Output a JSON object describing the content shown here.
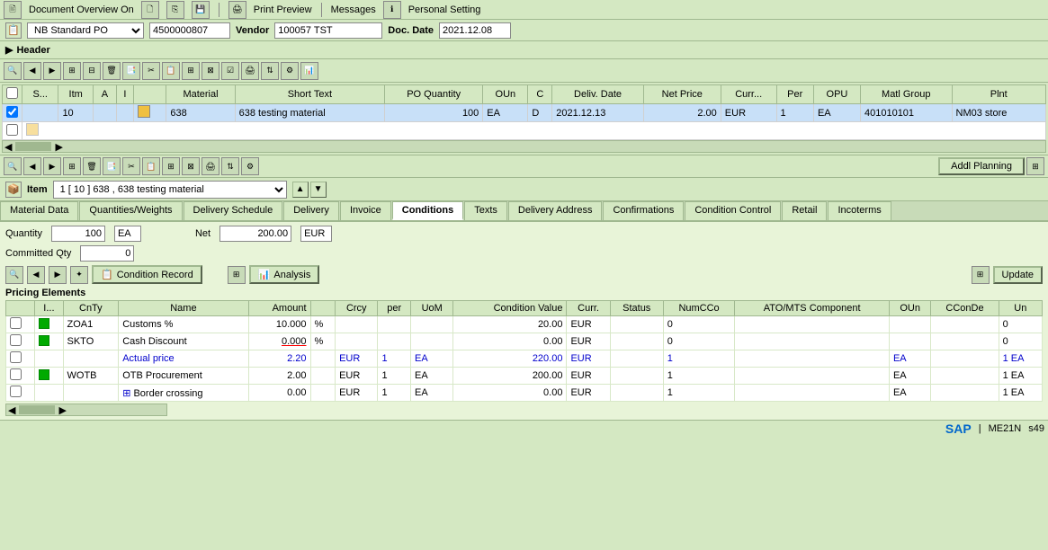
{
  "topbar": {
    "doc_overview": "Document Overview On",
    "print_preview": "Print Preview",
    "messages": "Messages",
    "personal_setting": "Personal Setting"
  },
  "header": {
    "label": "Header",
    "po_type_label": "NB Standard PO",
    "po_number": "4500000807",
    "vendor_label": "Vendor",
    "vendor_value": "100057 TST",
    "doc_date_label": "Doc. Date",
    "doc_date": "2021.12.08"
  },
  "po_table": {
    "columns": [
      "S...",
      "Itm",
      "A",
      "I",
      "Material",
      "Short Text",
      "PO Quantity",
      "OUn",
      "C",
      "Deliv. Date",
      "Net Price",
      "Curr...",
      "Per",
      "OPU",
      "Matl Group",
      "Plnt"
    ],
    "rows": [
      {
        "s": "",
        "itm": "10",
        "a": "",
        "i": "",
        "material": "638",
        "short_text": "638 testing material",
        "po_qty": "100",
        "oun": "EA",
        "c": "D",
        "deliv_date": "2021.12.13",
        "net_price": "2.00",
        "curr": "EUR",
        "per": "1",
        "opu": "EA",
        "matl_group": "401010101",
        "plnt": "NM03 store"
      }
    ]
  },
  "addl_planning": "Addl Planning",
  "item": {
    "label": "Item",
    "value": "1 [ 10 ] 638 , 638 testing material"
  },
  "tabs": [
    {
      "label": "Material Data",
      "active": false
    },
    {
      "label": "Quantities/Weights",
      "active": false
    },
    {
      "label": "Delivery Schedule",
      "active": false
    },
    {
      "label": "Delivery",
      "active": false
    },
    {
      "label": "Invoice",
      "active": false
    },
    {
      "label": "Conditions",
      "active": true
    },
    {
      "label": "Texts",
      "active": false
    },
    {
      "label": "Delivery Address",
      "active": false
    },
    {
      "label": "Confirmations",
      "active": false
    },
    {
      "label": "Condition Control",
      "active": false
    },
    {
      "label": "Retail",
      "active": false
    },
    {
      "label": "Incoterms",
      "active": false
    }
  ],
  "conditions": {
    "quantity_label": "Quantity",
    "quantity_value": "100",
    "quantity_unit": "EA",
    "net_label": "Net",
    "net_value": "200.00",
    "net_currency": "EUR",
    "committed_qty_label": "Committed Qty",
    "committed_qty_value": "0",
    "condition_record_btn": "Condition Record",
    "analysis_btn": "Analysis",
    "update_btn": "Update",
    "pricing_elements_label": "Pricing Elements"
  },
  "pricing_table": {
    "columns": [
      "I...",
      "CnTy",
      "Name",
      "Amount",
      "",
      "Crcy",
      "per",
      "UoM",
      "Condition Value",
      "",
      "Curr.",
      "Status",
      "NumCCo",
      "ATO/MTS Component",
      "OUn",
      "CConDe",
      "Un"
    ],
    "rows": [
      {
        "ind": "",
        "cnty": "ZOA1",
        "name": "Customs %",
        "amount": "10.000",
        "pct": "%",
        "crcy": "",
        "per": "",
        "uom": "",
        "cond_val": "20.00",
        "cv2": "",
        "curr": "EUR",
        "status": "",
        "numcco": "0",
        "ato": "",
        "oun": "",
        "cconde": "",
        "un": "0",
        "has_green": true,
        "is_actual": false,
        "is_strikethrough": false
      },
      {
        "ind": "",
        "cnty": "SKTO",
        "name": "Cash Discount",
        "amount": "0.000",
        "pct": "%",
        "crcy": "",
        "per": "",
        "uom": "",
        "cond_val": "0.00",
        "cv2": "",
        "curr": "EUR",
        "status": "",
        "numcco": "0",
        "ato": "",
        "oun": "",
        "cconde": "",
        "un": "0",
        "has_green": true,
        "is_actual": false,
        "is_strikethrough": false,
        "amount_underline_red": true
      },
      {
        "ind": "",
        "cnty": "",
        "name": "Actual price",
        "amount": "2.20",
        "pct": "",
        "crcy": "EUR",
        "per": "1",
        "uom": "EA",
        "cond_val": "220.00",
        "cv2": "",
        "curr": "EUR",
        "status": "",
        "numcco": "1",
        "ato": "",
        "oun": "EA",
        "cconde": "",
        "un": "1 EA",
        "has_green": false,
        "is_actual": true,
        "is_strikethrough": false
      },
      {
        "ind": "",
        "cnty": "WOTB",
        "name": "OTB Procurement",
        "amount": "2.00",
        "pct": "",
        "crcy": "EUR",
        "per": "1",
        "uom": "EA",
        "cond_val": "200.00",
        "cv2": "",
        "curr": "EUR",
        "status": "",
        "numcco": "1",
        "ato": "",
        "oun": "EA",
        "cconde": "",
        "un": "1 EA",
        "has_green": true,
        "is_actual": false,
        "is_strikethrough": false
      },
      {
        "ind": "",
        "cnty": "",
        "name": "Border crossing",
        "amount": "0.00",
        "pct": "",
        "crcy": "EUR",
        "per": "1",
        "uom": "EA",
        "cond_val": "0.00",
        "cv2": "",
        "curr": "EUR",
        "status": "",
        "numcco": "1",
        "ato": "",
        "oun": "EA",
        "cconde": "",
        "un": "1 EA",
        "has_green": false,
        "is_actual": false,
        "is_strikethrough": false
      }
    ]
  },
  "statusbar": {
    "transaction": "ME21N",
    "server_num": "s49"
  }
}
